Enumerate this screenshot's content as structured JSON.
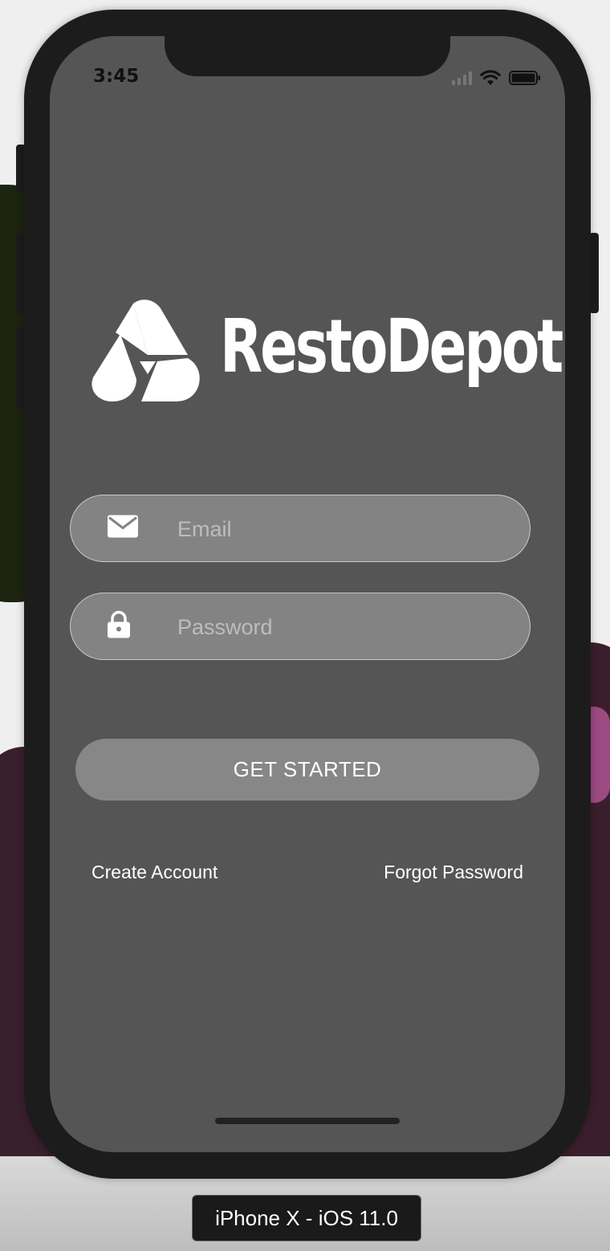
{
  "status_bar": {
    "time": "3:45",
    "signal_icon": "cellular-signal-icon",
    "wifi_icon": "wifi-icon",
    "battery_icon": "battery-icon"
  },
  "logo": {
    "text": "RestoDepot",
    "mark_icon": "restodepot-logo-mark"
  },
  "login_form": {
    "email": {
      "placeholder": "Email",
      "value": "",
      "icon": "envelope-icon"
    },
    "password": {
      "placeholder": "Password",
      "value": "",
      "icon": "lock-icon"
    },
    "submit_label": "GET STARTED"
  },
  "links": {
    "create_account": "Create Account",
    "forgot_password": "Forgot Password"
  },
  "simulator": {
    "device_label": "iPhone X - iOS 11.0"
  },
  "colors": {
    "screen_background": "#555555",
    "field_background": "#838383",
    "button_background": "#878787",
    "text_primary": "#ffffff",
    "placeholder": "#bdbdbd"
  }
}
